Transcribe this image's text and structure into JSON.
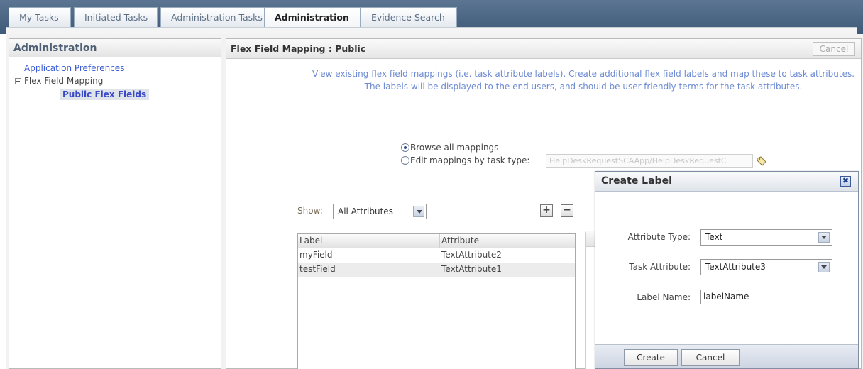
{
  "tabs": [
    {
      "label": "My Tasks",
      "active": false
    },
    {
      "label": "Initiated Tasks",
      "active": false
    },
    {
      "label": "Administration Tasks",
      "active": false
    },
    {
      "label": "Administration",
      "active": true
    },
    {
      "label": "Evidence Search",
      "active": false
    }
  ],
  "sidebar": {
    "title": "Administration",
    "link_app_prefs": "Application Preferences",
    "section_flex": "Flex Field Mapping",
    "selected_item": "Public Flex Fields"
  },
  "main": {
    "title": "Flex Field Mapping : Public",
    "cancel_label": "Cancel",
    "description_line1": "View existing flex field mappings (i.e. task attribute labels). Create additional flex field labels and map these to task attributes.",
    "description_line2": "The labels will be displayed to the end users, and should be user-friendly terms for the task attributes.",
    "radio_browse": "Browse all mappings",
    "radio_edit": "Edit mappings by task type:",
    "task_type_value": "HelpDeskRequestSCAApp/HelpDeskRequestC",
    "show_label": "Show:",
    "show_value": "All Attributes",
    "table": {
      "headers": [
        "Label",
        "Attribute"
      ],
      "rows": [
        [
          "myField",
          "TextAttribute2"
        ],
        [
          "testField",
          "TextAttribute1"
        ]
      ]
    }
  },
  "dialog": {
    "title": "Create Label",
    "attribute_type_label": "Attribute Type:",
    "attribute_type_value": "Text",
    "task_attribute_label": "Task Attribute:",
    "task_attribute_value": "TextAttribute3",
    "label_name_label": "Label Name:",
    "label_name_value": "labelName",
    "create_label": "Create",
    "cancel_label": "Cancel"
  },
  "icons": {
    "add": "+",
    "remove": "−",
    "close": "✖"
  }
}
